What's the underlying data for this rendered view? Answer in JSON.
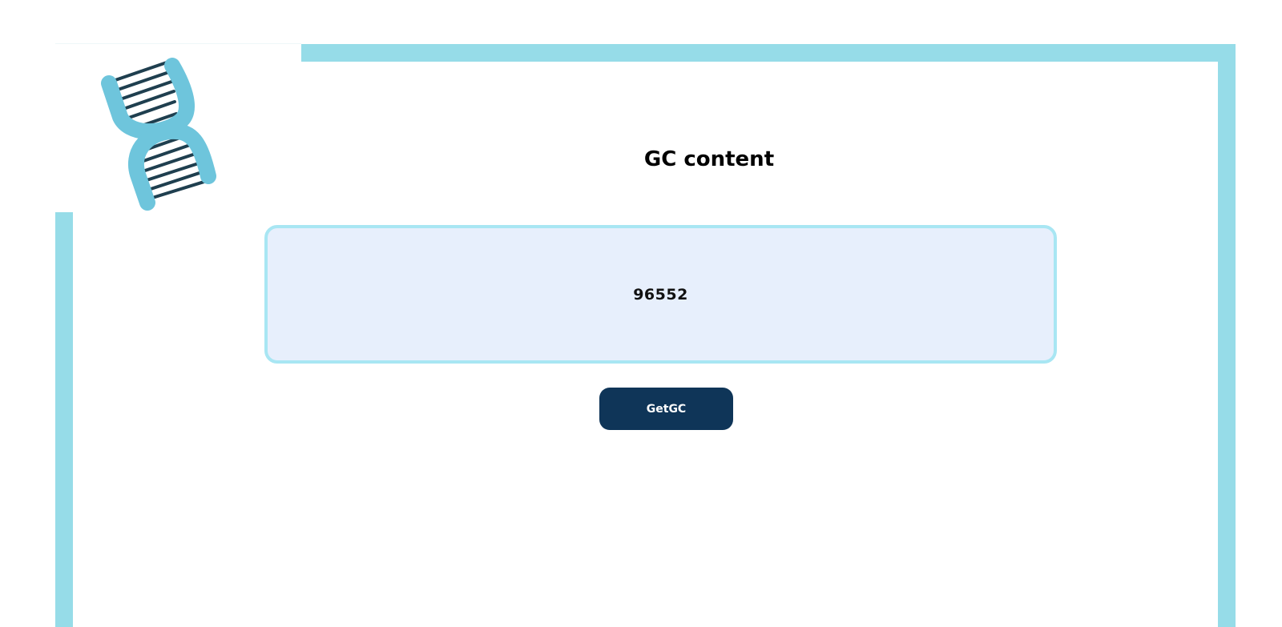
{
  "page": {
    "title": "GC content"
  },
  "result": {
    "value": "96552"
  },
  "actions": {
    "get_gc_label": "GetGC"
  },
  "logo": {
    "icon": "dna-icon"
  },
  "colors": {
    "frame": "#96dce8",
    "result_border": "#a8e6f3",
    "result_background": "#e7effc",
    "button_background": "#0f3558",
    "button_text": "#ffffff",
    "helix_strand": "#6ec5dc",
    "helix_rung": "#1f3f4f"
  }
}
